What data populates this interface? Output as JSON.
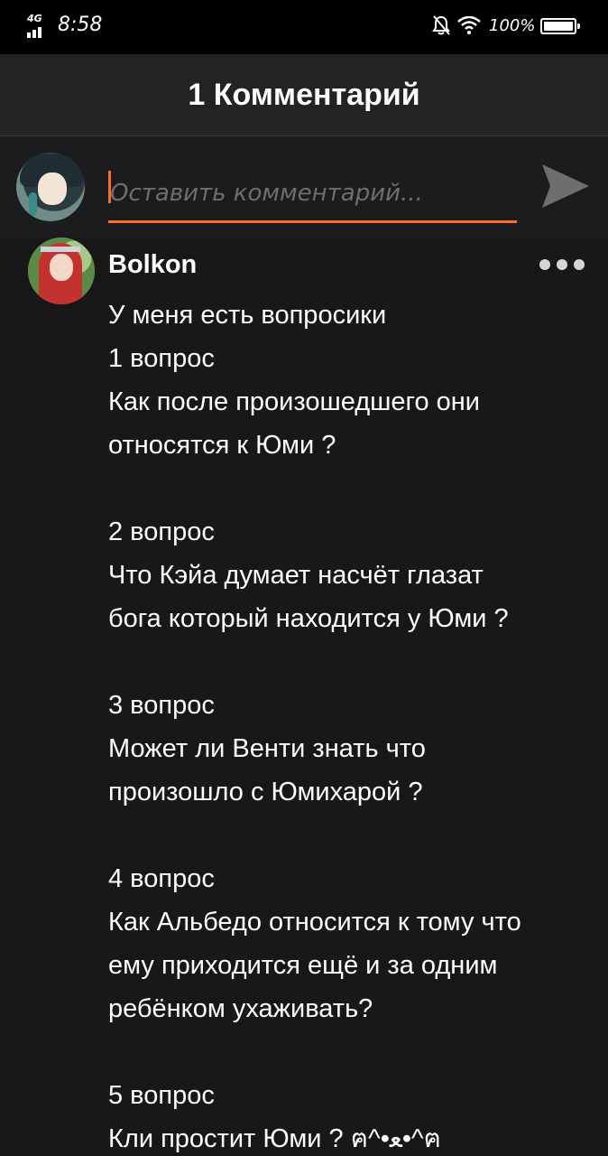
{
  "status_bar": {
    "network": "4G",
    "time": "8:58",
    "battery_text": "100%",
    "icons": [
      "signal-icon",
      "bell-off-icon",
      "wifi-icon",
      "battery-icon"
    ]
  },
  "header": {
    "title": "1 Комментарий"
  },
  "composer": {
    "placeholder": "Оставить комментарий...",
    "accent_color": "#ff6b2b",
    "send_icon": "send-icon"
  },
  "comment": {
    "author": "Bolkon",
    "more_icon": "more-dots-icon",
    "lines": [
      "У меня есть вопросики",
      "1 вопрос",
      "Как после произошедшего они",
      "относятся к Юми ?",
      "",
      "2 вопрос",
      "Что Кэйа думает насчёт глазат",
      "бога который находится у Юми ?",
      "",
      "3 вопрос",
      "Может ли Венти знать что",
      "произошло с Юмихарой ?",
      "",
      "4 вопрос",
      "Как Альбедо относится к тому что",
      "ему приходится ещё и за одним",
      "ребёнком ухаживать?",
      "",
      "5 вопрос",
      "Кли простит Юми ? ฅ^•ﻌ•^ฅ"
    ]
  }
}
